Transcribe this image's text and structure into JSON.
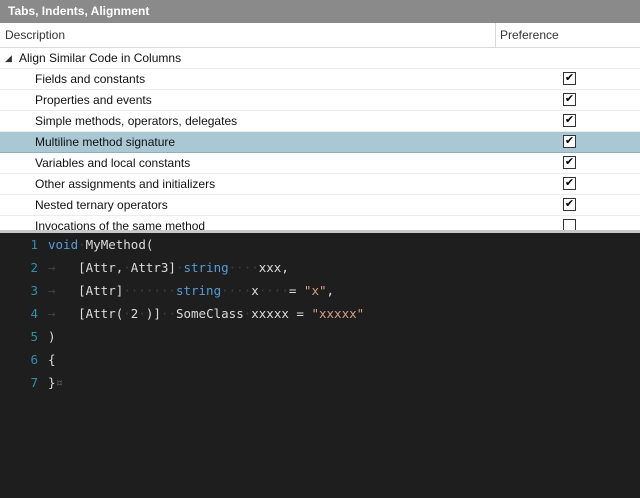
{
  "panel": {
    "title": "Tabs, Indents, Alignment"
  },
  "grid": {
    "col_description": "Description",
    "col_preference": "Preference",
    "group": {
      "label": "Align Similar Code in Columns"
    },
    "rows": [
      {
        "label": "Fields and constants",
        "checked": true
      },
      {
        "label": "Properties and events",
        "checked": true
      },
      {
        "label": "Simple methods, operators, delegates",
        "checked": true
      },
      {
        "label": "Multiline method signature",
        "checked": true,
        "selected": true
      },
      {
        "label": "Variables and local constants",
        "checked": true
      },
      {
        "label": "Other assignments and initializers",
        "checked": true
      },
      {
        "label": "Nested ternary operators",
        "checked": true
      },
      {
        "label": "Invocations of the same method",
        "checked": false
      }
    ]
  },
  "editor": {
    "line_numbers": [
      "1",
      "2",
      "3",
      "4",
      "5",
      "6",
      "7"
    ],
    "t": {
      "void": "void",
      "method": "MyMethod(",
      "attr1": "[Attr,",
      "attr3": "Attr3]",
      "string": "string",
      "xxx": "xxx,",
      "attr": "[Attr]",
      "x": "x",
      "eq": "=",
      "xstr": "\"x\"",
      "comma": ",",
      "attr2a": "[Attr(",
      "two": "2",
      "attr2b": ")]",
      "someclass": "SomeClass",
      "xxxxx": "xxxxx",
      "xxxxxstr": "\"xxxxx\"",
      "close_paren": ")",
      "open_brace": "{",
      "close_brace": "}",
      "tab_glyph": "→",
      "dot": "·",
      "dots2": "··",
      "dots3": "···",
      "dots4": "····",
      "dots7": "·······",
      "end_glyph": "¤"
    }
  }
}
